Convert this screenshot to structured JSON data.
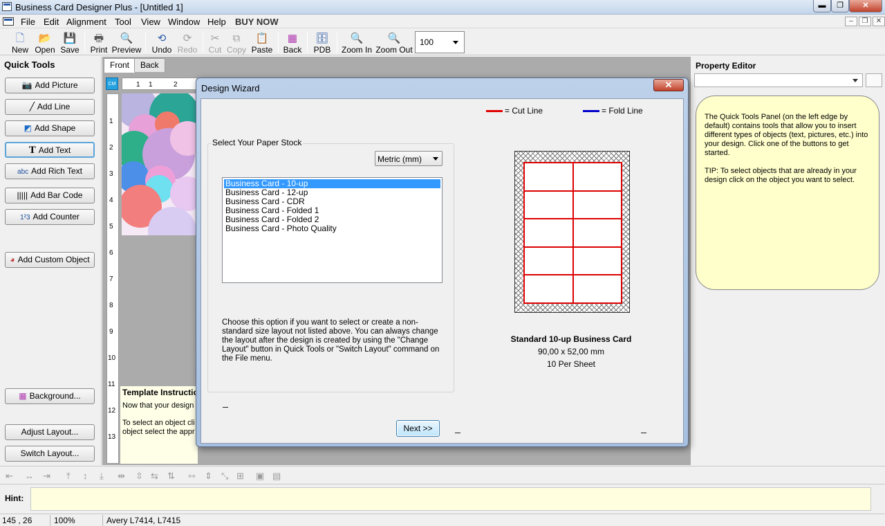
{
  "window": {
    "title": "Business Card Designer Plus  - [Untitled 1]"
  },
  "menubar": {
    "items": [
      "File",
      "Edit",
      "Alignment",
      "Tool",
      "View",
      "Window",
      "Help",
      "BUY NOW"
    ]
  },
  "toolbar": {
    "new": "New",
    "open": "Open",
    "save": "Save",
    "print": "Print",
    "preview": "Preview",
    "undo": "Undo",
    "redo": "Redo",
    "cut": "Cut",
    "copy": "Copy",
    "paste": "Paste",
    "back": "Back",
    "pdb": "PDB",
    "zoom_in": "Zoom In",
    "zoom_out": "Zoom Out",
    "zoom_value": "100"
  },
  "quick_tools": {
    "title": "Quick Tools",
    "add_picture": "Add Picture",
    "add_line": "Add Line",
    "add_shape": "Add Shape",
    "add_text": "Add Text",
    "add_rich_text": "Add Rich Text",
    "add_bar_code": "Add Bar Code",
    "add_counter": "Add Counter",
    "add_custom_object": "Add Custom Object",
    "background": "Background...",
    "adjust_layout": "Adjust Layout...",
    "switch_layout": "Switch Layout..."
  },
  "document": {
    "tabs": [
      "Front",
      "Back"
    ],
    "ruler_unit": "CM",
    "ruler_h": [
      "1",
      "1",
      "2"
    ],
    "ruler_v": [
      "1",
      "2",
      "3",
      "4",
      "5",
      "6",
      "7",
      "8",
      "9",
      "10",
      "11",
      "12",
      "13"
    ],
    "instructions_title": "Template Instruction",
    "instructions_lines": [
      "Now that your design i",
      "To select an object cli",
      "object select the appr"
    ]
  },
  "property_editor": {
    "title": "Property Editor",
    "help_paragraphs": [
      "The Quick Tools Panel (on the left edge by default) contains tools that allow you to insert different types of objects (text, pictures, etc.) into your design. Click one of the buttons to get started.",
      "TIP: To select objects that are already in your design click on the object you want to select."
    ]
  },
  "dialog": {
    "title": "Design Wizard",
    "close": "✕",
    "group_label": "Select Your Paper Stock",
    "unit_value": "Metric (mm)",
    "stocks": [
      "Business Card - 10-up",
      "Business Card - 12-up",
      "Business Card - CDR",
      "Business Card - Folded 1",
      "Business Card - Folded 2",
      "Business Card - Photo Quality"
    ],
    "description": "Choose this option if you want to select or create a non-standard size layout not listed above. You can always change the layout after the design is created by using the \"Change Layout\" button in Quick Tools or \"Switch Layout\" command on the File menu.",
    "legend_cut": "= Cut Line",
    "legend_fold": "= Fold Line",
    "cut_color": "#e00000",
    "fold_color": "#0000cc",
    "layout_name": "Standard 10-up Business Card",
    "layout_size": "90,00 x 52,00 mm",
    "layout_per_sheet": "10 Per Sheet",
    "next_label": "Next >>"
  },
  "hint": {
    "label": "Hint:",
    "text": ""
  },
  "status": {
    "coords": "145 , 26",
    "zoom": "100%",
    "paper": "Avery L7414, L7415"
  }
}
